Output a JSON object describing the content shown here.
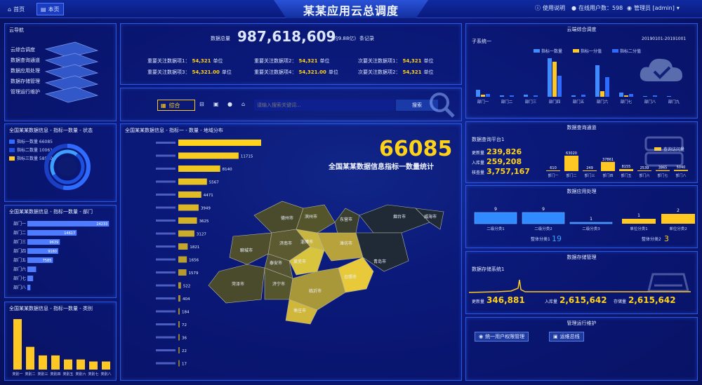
{
  "header": {
    "tabs": [
      {
        "label": "首页",
        "icon": "home-icon"
      },
      {
        "label": "本页",
        "icon": "page-icon"
      }
    ],
    "title": "某某应用云总调度",
    "help": "使用说明",
    "online": "在线用户数：598",
    "admin": "管理员 [admin]"
  },
  "nav": {
    "title": "云导航",
    "items": [
      "云综合调度",
      "数据查询通道",
      "数据应用处理",
      "数据存储管理",
      "管理运行维护"
    ]
  },
  "status": {
    "title": "全国某某数据信息 - 指标一数量 - 状态",
    "legend": [
      {
        "label": "指标一数量 66085",
        "color": "#2f6bff"
      },
      {
        "label": "指标二数量 100610",
        "color": "#1e50e0"
      },
      {
        "label": "指标三数量 58590",
        "color": "#ffc822"
      }
    ]
  },
  "dept": {
    "title": "全国某某数据信息 - 指标一数量 - 部门",
    "chart_data": {
      "type": "bar",
      "categories": [
        "部门一",
        "部门二",
        "部门三",
        "部门四",
        "部门五",
        "部门六",
        "部门七",
        "部门八"
      ],
      "values": [
        24233,
        14617,
        9639,
        9160,
        7585,
        2600,
        1700,
        900
      ],
      "labels": [
        "24233",
        "14617",
        "9639",
        "9160",
        "7585",
        "",
        "",
        ""
      ],
      "color": "#4f7cff"
    }
  },
  "category": {
    "title": "全国某某数据信息 - 指标一数量 - 类别",
    "chart_data": {
      "type": "bar",
      "categories": [
        "类别一",
        "类别二",
        "类别三",
        "类别四",
        "类别五",
        "类别六",
        "类别七",
        "类别八"
      ],
      "values": [
        100,
        45,
        28,
        28,
        20,
        20,
        16,
        16
      ],
      "color": "#ffc822"
    }
  },
  "summary": {
    "total_label": "数据总量",
    "total_value": "987,618,609",
    "total_note": "(约9.88亿)",
    "total_suffix": "条记录",
    "items": [
      {
        "label": "重要关注数据项1：",
        "value": "54,321",
        "unit": "单位"
      },
      {
        "label": "重要关注数据项2：",
        "value": "54,321",
        "unit": "单位"
      },
      {
        "label": "次要关注数据项1：",
        "value": "54,321",
        "unit": "单位"
      },
      {
        "label": "重要关注数据项3：",
        "value": "54,321.00",
        "unit": "单位"
      },
      {
        "label": "重要关注数据项4：",
        "value": "54,321.00",
        "unit": "单位"
      },
      {
        "label": "次要关注数据项2：",
        "value": "54,321",
        "unit": "单位"
      }
    ]
  },
  "search": {
    "active_tab": "综合",
    "placeholder": "请输入搜索关键词...",
    "button": "搜索"
  },
  "region": {
    "title": "全国某某数据信息 - 指标一 - 数量 - 地域分布",
    "big_number": "66085",
    "big_caption": "全国某某数据信息指标一数量统计",
    "chart_data": {
      "type": "bar",
      "orientation": "horizontal",
      "values": [
        19101,
        11715,
        8140,
        5567,
        4471,
        3949,
        3625,
        3127,
        1821,
        1656,
        1579,
        522,
        404,
        184,
        72,
        36,
        22,
        17
      ],
      "labels": [
        "19101",
        "11715",
        "8140",
        "5567",
        "4471",
        "3949",
        "3625",
        "3127",
        "1821",
        "1656",
        "1579",
        "522",
        "404",
        "184",
        "72",
        "36",
        "22",
        "17"
      ]
    },
    "map_cities": [
      "德州市",
      "滨州市",
      "东营市",
      "烟台市",
      "威海市",
      "济南市",
      "淄博市",
      "潍坊市",
      "聊城市",
      "泰安市",
      "莱芜市",
      "青岛市",
      "菏泽市",
      "济宁市",
      "临沂市",
      "日照市",
      "枣庄市"
    ]
  },
  "cloud": {
    "title": "云端综合调度",
    "subtitle": "子系统一",
    "date": "20190101-20191001",
    "chart_data": {
      "type": "bar",
      "categories": [
        "部门一",
        "部门二",
        "部门三",
        "部门四",
        "部门五",
        "部门六",
        "部门七",
        "部门八",
        "部门九"
      ],
      "series": [
        {
          "name": "指标一数量",
          "color": "#3f8bff",
          "values": [
            10,
            2,
            3,
            55,
            2,
            45,
            6,
            1,
            1
          ]
        },
        {
          "name": "指标一分值",
          "color": "#ffc822",
          "values": [
            3,
            0,
            0,
            50,
            0,
            8,
            2,
            0,
            0
          ]
        },
        {
          "name": "指标二分值",
          "color": "#2f6bff",
          "values": [
            4,
            2,
            2,
            30,
            3,
            28,
            4,
            2,
            0
          ]
        }
      ]
    }
  },
  "query": {
    "title": "数据查询通道",
    "subtitle": "数据查询平台1",
    "stats": [
      {
        "label": "更新量",
        "value": "239,826"
      },
      {
        "label": "入库量",
        "value": "259,208"
      },
      {
        "label": "核查量",
        "value": "3,757,167"
      }
    ],
    "legend": "查询访问量",
    "chart_data": {
      "type": "bar",
      "categories": [
        "部门一",
        "部门二",
        "部门三",
        "部门四",
        "部门五",
        "部门六",
        "部门七",
        "部门八"
      ],
      "values": [
        610,
        63020,
        249,
        37861,
        8155,
        2539,
        3865,
        5040
      ],
      "labels": [
        "610",
        "63020",
        "249",
        "37861",
        "8155",
        "2539",
        "3865",
        "5040"
      ]
    }
  },
  "apply": {
    "title": "数据应用处理",
    "groups": [
      {
        "bars": [
          {
            "label": "二级分类1",
            "value": 9
          },
          {
            "label": "二级分类2",
            "value": 9
          },
          {
            "label": "二级分类3",
            "value": 1
          }
        ],
        "total_label": "整体分类1",
        "total": "19"
      },
      {
        "bars": [
          {
            "label": "单位分类1",
            "value": 1
          },
          {
            "label": "单位分类2",
            "value": 2
          }
        ],
        "total_label": "整体分类2",
        "total": "3"
      }
    ]
  },
  "storage": {
    "title": "数据存储管理",
    "subtitle": "数据存储系统1",
    "stats": [
      {
        "label": "更新量",
        "value": "346,881"
      },
      {
        "label": "入库量",
        "value": "2,615,642"
      },
      {
        "label": "存储量",
        "value": "2,615,642"
      }
    ]
  },
  "maint": {
    "title": "管理运行维护",
    "buttons": [
      "统一用户权限管理",
      "运维总线"
    ]
  }
}
